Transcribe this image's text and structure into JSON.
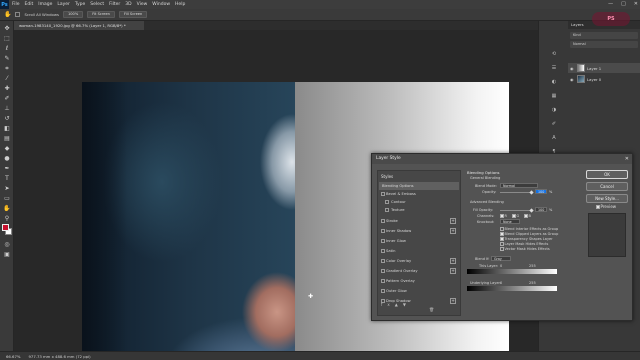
{
  "app": {
    "logo": "Ps"
  },
  "menubar": {
    "items": [
      "File",
      "Edit",
      "Image",
      "Layer",
      "Type",
      "Select",
      "Filter",
      "3D",
      "View",
      "Window",
      "Help"
    ],
    "window_controls": [
      "—",
      "□",
      "✕"
    ]
  },
  "options_bar": {
    "tool_icon": "hand-icon",
    "chips": [
      "Scroll All Windows",
      "100%",
      "Fit Screen",
      "Fill Screen"
    ]
  },
  "document": {
    "tab_title": "woman-1983140_1920.jpg @ 66.7% (Layer 1, RGB/8*) *",
    "status_zoom": "66.67%",
    "status_info": "977.73 mm x 488.6 mm (72 ppi)"
  },
  "colors": {
    "foreground": "#c8102e",
    "background": "#ffffff",
    "ui_bg": "#282828",
    "dialog_bg": "#535353"
  },
  "layers_panel": {
    "header": "Layers",
    "kind_label": "Kind",
    "mode": "Normal",
    "layers": [
      {
        "name": "Layer 1",
        "selected": true
      },
      {
        "name": "Layer 0",
        "selected": false
      }
    ]
  },
  "watermark": "PS",
  "layer_style": {
    "title": "Layer Style",
    "styles_header": "Styles",
    "styles": [
      {
        "label": "Blending Options",
        "selected": true,
        "checkbox": false,
        "plus": false
      },
      {
        "label": "Bevel & Emboss",
        "selected": false,
        "checkbox": true,
        "plus": false
      },
      {
        "label": "Contour",
        "selected": false,
        "checkbox": true,
        "plus": false,
        "indent": true
      },
      {
        "label": "Texture",
        "selected": false,
        "checkbox": true,
        "plus": false,
        "indent": true
      },
      {
        "label": "Stroke",
        "selected": false,
        "checkbox": true,
        "plus": true
      },
      {
        "label": "Inner Shadow",
        "selected": false,
        "checkbox": true,
        "plus": true
      },
      {
        "label": "Inner Glow",
        "selected": false,
        "checkbox": true,
        "plus": false
      },
      {
        "label": "Satin",
        "selected": false,
        "checkbox": true,
        "plus": false
      },
      {
        "label": "Color Overlay",
        "selected": false,
        "checkbox": true,
        "plus": true
      },
      {
        "label": "Gradient Overlay",
        "selected": false,
        "checkbox": true,
        "plus": true
      },
      {
        "label": "Pattern Overlay",
        "selected": false,
        "checkbox": true,
        "plus": false
      },
      {
        "label": "Outer Glow",
        "selected": false,
        "checkbox": true,
        "plus": false
      },
      {
        "label": "Drop Shadow",
        "selected": false,
        "checkbox": true,
        "plus": true
      }
    ],
    "blending": {
      "heading": "Blending Options",
      "general": "General Blending",
      "blend_mode_label": "Blend Mode:",
      "blend_mode_value": "Normal",
      "opacity_label": "Opacity:",
      "opacity_value": "100",
      "advanced": "Advanced Blending",
      "fill_label": "Fill Opacity:",
      "fill_value": "100",
      "channels_label": "Channels:",
      "channels": [
        "R",
        "G",
        "B"
      ],
      "knockout_label": "Knockout:",
      "knockout_value": "None",
      "options": [
        {
          "label": "Blend Interior Effects as Group",
          "checked": false
        },
        {
          "label": "Blend Clipped Layers as Group",
          "checked": true
        },
        {
          "label": "Transparency Shapes Layer",
          "checked": true
        },
        {
          "label": "Layer Mask Hides Effects",
          "checked": false
        },
        {
          "label": "Vector Mask Hides Effects",
          "checked": false
        }
      ],
      "blend_if_label": "Blend If:",
      "blend_if_value": "Gray",
      "this_layer_label": "This Layer:",
      "this_layer_values": [
        "0",
        "255"
      ],
      "underlying_label": "Underlying Layer:",
      "underlying_values": [
        "0",
        "255"
      ],
      "percent": "%"
    },
    "buttons": {
      "ok": "OK",
      "cancel": "Cancel",
      "new_style": "New Style...",
      "preview": "Preview"
    }
  }
}
